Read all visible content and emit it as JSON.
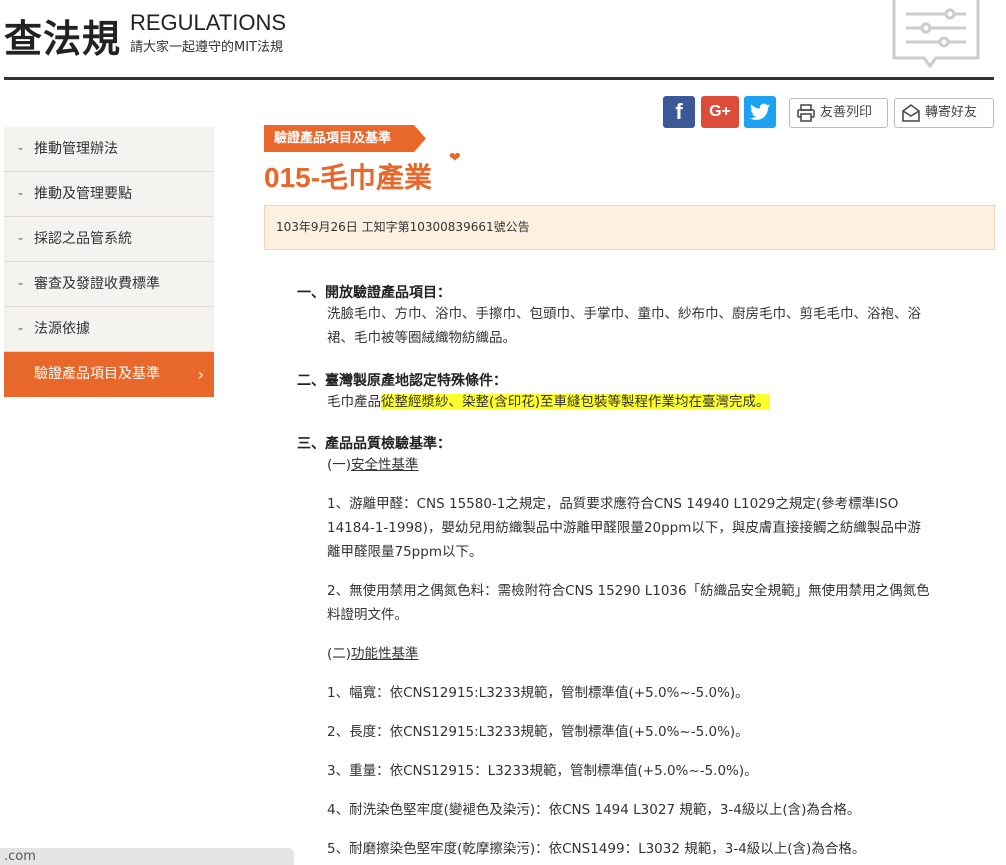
{
  "header": {
    "title": "查法規",
    "title_en": "REGULATIONS",
    "subtitle": "請大家一起遵守的MIT法規"
  },
  "share": {
    "facebook": "f",
    "google": "G+",
    "twitter_icon": "twitter-bird-icon",
    "print_label": "友善列印",
    "mail_label": "轉寄好友"
  },
  "sidebar": {
    "items": [
      {
        "label": "推動管理辦法",
        "active": false
      },
      {
        "label": "推動及管理要點",
        "active": false
      },
      {
        "label": "採認之品管系統",
        "active": false
      },
      {
        "label": "審查及發證收費標準",
        "active": false
      },
      {
        "label": "法源依據",
        "active": false
      },
      {
        "label": "驗證產品項目及基準",
        "active": true
      }
    ],
    "dash": "-",
    "chevron": "›"
  },
  "main": {
    "tag": "驗證產品項目及基準",
    "title": "015-毛巾產業",
    "heart": "❤",
    "notice": "103年9月26日 工知字第10300839661號公告",
    "sections": [
      {
        "heading": "一、開放驗證產品項目：",
        "lines": [
          "洗臉毛巾、方巾、浴巾、手擦巾、包頭巾、手掌巾、童巾、紗布巾、廚房毛巾、剪毛毛巾、浴袍、浴",
          "裙、毛巾被等圈絨織物紡織品。"
        ]
      },
      {
        "heading": "二、臺灣製原產地認定特殊條件：",
        "line_prefix": "毛巾產品",
        "line_highlight": "從整經漿紗、染整(含印花)至車縫包裝等製程作業均在臺灣完成。"
      },
      {
        "heading": "三、產品品質檢驗基準：",
        "sub1_prefix": "(一)",
        "sub1": "安全性基準",
        "item1": [
          "1、游離甲醛：CNS 15580-1之規定，品質要求應符合CNS 14940 L1029之規定(參考標準ISO",
          "14184-1-1998)，嬰幼兒用紡織製品中游離甲醛限量20ppm以下，與皮膚直接接觸之紡織製品中游",
          "離甲醛限量75ppm以下。"
        ],
        "item2": [
          "2、無使用禁用之偶氮色料：需檢附符合CNS 15290 L1036「紡織品安全規範」無使用禁用之偶氮色",
          "料證明文件。"
        ],
        "sub2_prefix": "(二)",
        "sub2": "功能性基準",
        "func_items": [
          "1、幅寬：依CNS12915:L3233規範，管制標準值(+5.0%~-5.0%)。",
          "2、長度：依CNS12915:L3233規範，管制標準值(+5.0%~-5.0%)。",
          "3、重量：依CNS12915：L3233規範，管制標準值(+5.0%~-5.0%)。",
          "4、耐洗染色堅牢度(變褪色及染污)：依CNS 1494 L3027 規範，3-4級以上(含)為合格。",
          "5、耐磨擦染色堅牢度(乾摩擦染污)：依CNS1499：L3032 規範，3-4級以上(含)為合格。"
        ]
      }
    ]
  },
  "status_bar": {
    "url": ".com"
  },
  "colors": {
    "accent": "#e8672b",
    "highlight": "#ffff2b",
    "facebook": "#3b5998",
    "google": "#dd4b39",
    "twitter": "#1da1f2"
  }
}
